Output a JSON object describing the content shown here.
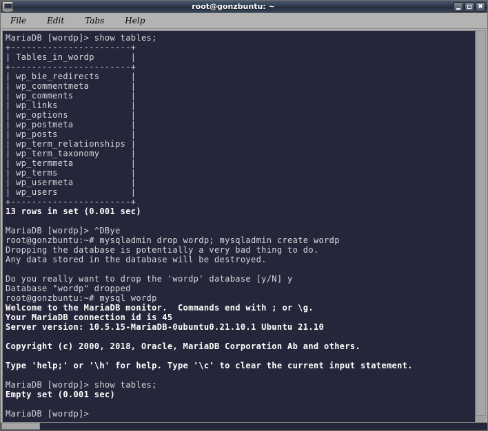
{
  "window": {
    "title": "root@gonzbuntu: ~",
    "icon": "terminal-monitor-icon",
    "controls": {
      "minimize_label": "",
      "maximize_label": "",
      "close_label": "✖"
    }
  },
  "menubar": {
    "items": [
      {
        "label": "File"
      },
      {
        "label": "Edit"
      },
      {
        "label": "Tabs"
      },
      {
        "label": "Help"
      }
    ]
  },
  "colors": {
    "terminal_background": "#26263a",
    "terminal_foreground": "#d8d8dc",
    "terminal_bold": "#ffffff",
    "titlebar_background": "#2e3a4d",
    "menubar_background": "#b3b3b3",
    "scrollbar": "#a6a6a6"
  },
  "terminal": {
    "lines": [
      {
        "text": "MariaDB [wordp]> show tables;",
        "bold": false
      },
      {
        "text": "+-----------------------+",
        "bold": false
      },
      {
        "text": "| Tables_in_wordp       |",
        "bold": false
      },
      {
        "text": "+-----------------------+",
        "bold": false
      },
      {
        "text": "| wp_bie_redirects      |",
        "bold": false
      },
      {
        "text": "| wp_commentmeta        |",
        "bold": false
      },
      {
        "text": "| wp_comments           |",
        "bold": false
      },
      {
        "text": "| wp_links              |",
        "bold": false
      },
      {
        "text": "| wp_options            |",
        "bold": false
      },
      {
        "text": "| wp_postmeta           |",
        "bold": false
      },
      {
        "text": "| wp_posts              |",
        "bold": false
      },
      {
        "text": "| wp_term_relationships |",
        "bold": false
      },
      {
        "text": "| wp_term_taxonomy      |",
        "bold": false
      },
      {
        "text": "| wp_termmeta           |",
        "bold": false
      },
      {
        "text": "| wp_terms              |",
        "bold": false
      },
      {
        "text": "| wp_usermeta           |",
        "bold": false
      },
      {
        "text": "| wp_users              |",
        "bold": false
      },
      {
        "text": "+-----------------------+",
        "bold": false
      },
      {
        "text": "13 rows in set (0.001 sec)",
        "bold": true
      },
      {
        "text": "",
        "bold": false
      },
      {
        "text": "MariaDB [wordp]> ^DBye",
        "bold": false
      },
      {
        "text": "root@gonzbuntu:~# mysqladmin drop wordp; mysqladmin create wordp",
        "bold": false
      },
      {
        "text": "Dropping the database is potentially a very bad thing to do.",
        "bold": false
      },
      {
        "text": "Any data stored in the database will be destroyed.",
        "bold": false
      },
      {
        "text": "",
        "bold": false
      },
      {
        "text": "Do you really want to drop the 'wordp' database [y/N] y",
        "bold": false
      },
      {
        "text": "Database \"wordp\" dropped",
        "bold": false
      },
      {
        "text": "root@gonzbuntu:~# mysql wordp",
        "bold": false
      },
      {
        "text": "Welcome to the MariaDB monitor.  Commands end with ; or \\g.",
        "bold": true
      },
      {
        "text": "Your MariaDB connection id is 45",
        "bold": true
      },
      {
        "text": "Server version: 10.5.15-MariaDB-0ubuntu0.21.10.1 Ubuntu 21.10",
        "bold": true
      },
      {
        "text": "",
        "bold": false
      },
      {
        "text": "Copyright (c) 2000, 2018, Oracle, MariaDB Corporation Ab and others.",
        "bold": true
      },
      {
        "text": "",
        "bold": false
      },
      {
        "text": "Type 'help;' or '\\h' for help. Type '\\c' to clear the current input statement.",
        "bold": true
      },
      {
        "text": "",
        "bold": false
      },
      {
        "text": "MariaDB [wordp]> show tables;",
        "bold": false
      },
      {
        "text": "Empty set (0.001 sec)",
        "bold": true
      },
      {
        "text": "",
        "bold": false
      },
      {
        "text": "MariaDB [wordp]>",
        "bold": false
      }
    ]
  }
}
